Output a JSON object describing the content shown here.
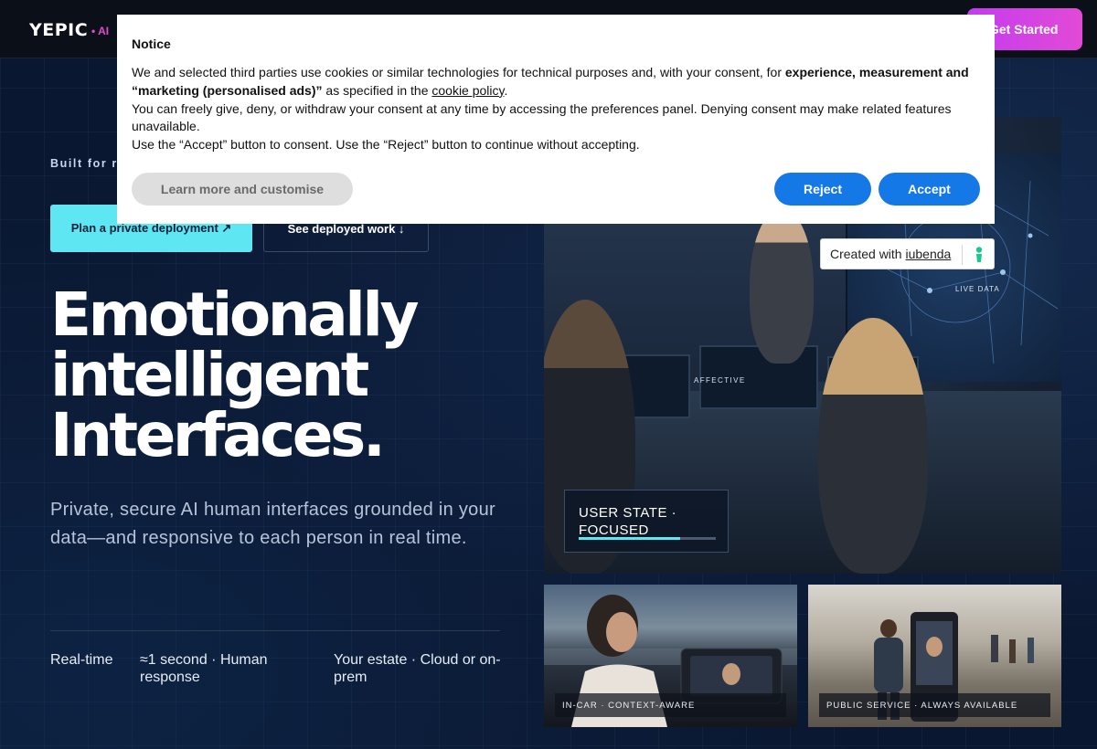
{
  "header": {
    "logo": "YEPIC",
    "logo_tag": "• AI",
    "cta_label": "Get Started"
  },
  "hero": {
    "eyebrow": "Built for re",
    "primary_button": "Plan a private deployment ↗",
    "secondary_button": "See deployed work ↓",
    "headline_lines": [
      "Emotionally",
      "intelligent",
      "Interfaces."
    ],
    "subhead": "Private, secure AI human interfaces grounded in your data—and responsive to each person in real time.",
    "stats": [
      "Real-time",
      "≈1 second · Human response",
      "Your estate · Cloud or on-prem"
    ]
  },
  "visual": {
    "affective_label": "AFFECTIVE",
    "live_label": "LIVE DATA",
    "state_card": "USER STATE · FOCUSED",
    "state_progress": 0.74,
    "tiles": [
      {
        "caption": "IN-CAR · CONTEXT-AWARE"
      },
      {
        "caption": "PUBLIC SERVICE · ALWAYS AVAILABLE"
      }
    ]
  },
  "notice": {
    "title": "Notice",
    "body_prefix": "We and selected third parties use cookies or similar technologies for technical purposes and, with your consent, for ",
    "body_bold": "experience, measurement and “marketing (personalised ads)”",
    "body_mid": " as specified in the ",
    "cookie_link": "cookie policy",
    "body_end": ".",
    "body_line2": "You can freely give, deny, or withdraw your consent at any time by accessing the preferences panel. Denying consent may make related features unavailable.",
    "body_line3": "Use the “Accept” button to consent. Use the “Reject” button to continue without accepting.",
    "learn_more": "Learn more and customise",
    "reject": "Reject",
    "accept": "Accept"
  },
  "badge": {
    "prefix": "Created with ",
    "link": "iubenda"
  },
  "colors": {
    "accent_cyan": "#5ee6f3",
    "accent_magenta": "#e24ad6",
    "notice_button_blue": "#1478e6",
    "background": "#0a1730"
  }
}
